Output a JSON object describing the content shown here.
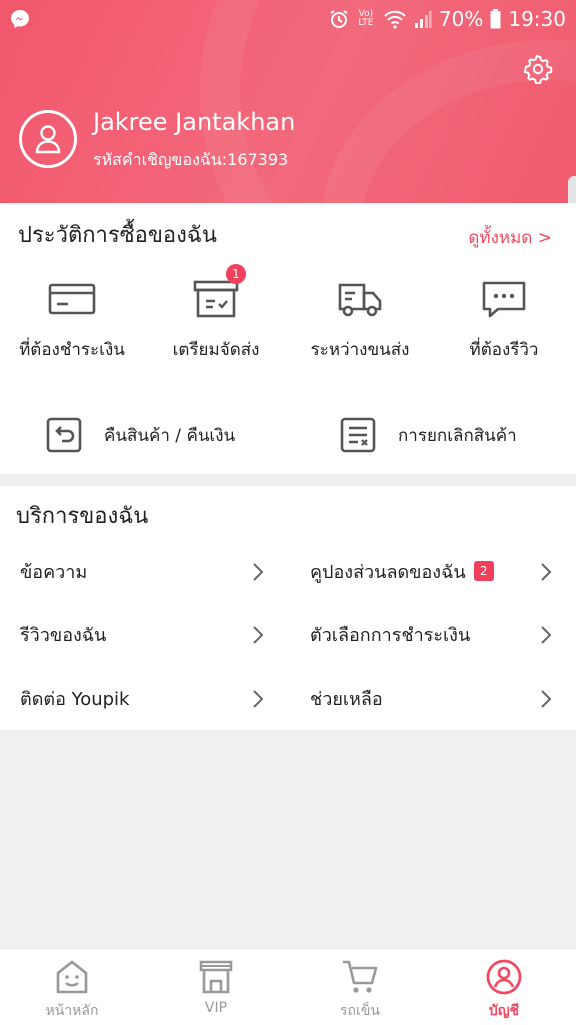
{
  "status_bar": {
    "battery": "70%",
    "time": "19:30",
    "network": "Vo) LTE",
    "icons": [
      "messenger-icon",
      "alarm-icon",
      "volte-icon",
      "wifi-icon",
      "signal-icon",
      "battery-icon"
    ]
  },
  "profile": {
    "name": "Jakree Jantakhan",
    "invite_code": "รหัสคำเชิญของฉัน:167393"
  },
  "orders": {
    "title": "ประวัติการซื้อของฉัน",
    "view_all": "ดูทั้งหมด >",
    "items": [
      {
        "label": "ที่ต้องชำระเงิน",
        "icon": "card-icon"
      },
      {
        "label": "เตรียมจัดส่ง",
        "icon": "box-icon",
        "badge": "1"
      },
      {
        "label": "ระหว่างขนส่ง",
        "icon": "truck-icon"
      },
      {
        "label": "ที่ต้องรีวิว",
        "icon": "chat-icon"
      }
    ],
    "returns": {
      "label": "คืนสินค้า / คืนเงิน",
      "icon": "return-icon"
    },
    "cancel": {
      "label": "การยกเลิกสินค้า",
      "icon": "cancel-list-icon"
    }
  },
  "services": {
    "title": "บริการของฉัน",
    "items": [
      {
        "label": "ข้อความ"
      },
      {
        "label": "คูปองส่วนลดของฉัน",
        "badge": "2"
      },
      {
        "label": "รีวิวของฉัน"
      },
      {
        "label": "ตัวเลือกการชำระเงิน"
      },
      {
        "label": "ติดต่อ Youpik"
      },
      {
        "label": "ช่วยเหลือ"
      }
    ]
  },
  "tabbar": {
    "items": [
      {
        "label": "หน้าหลัก",
        "icon": "home-icon"
      },
      {
        "label": "VIP",
        "icon": "store-icon"
      },
      {
        "label": "รถเข็น",
        "icon": "cart-icon"
      },
      {
        "label": "บัญชี",
        "icon": "account-icon"
      }
    ],
    "active": "บัญชี"
  },
  "colors": {
    "accent": "#ef4a62",
    "header": "#f2576c",
    "background": "#f0f0f2"
  }
}
